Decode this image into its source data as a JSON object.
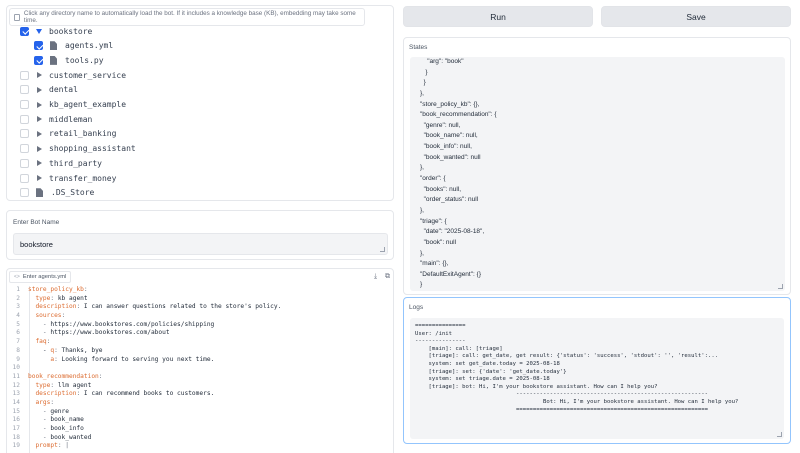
{
  "tree": {
    "info": "Click any directory name to automatically load the bot. If it includes a knowledge base (KB), embedding may take some time.",
    "items": [
      {
        "label": "bookstore",
        "checked": true,
        "type": "folder-open",
        "indent": 0
      },
      {
        "label": "agents.yml",
        "checked": true,
        "type": "file",
        "indent": 1
      },
      {
        "label": "tools.py",
        "checked": true,
        "type": "file",
        "indent": 1
      },
      {
        "label": "customer_service",
        "checked": false,
        "type": "folder",
        "indent": 0
      },
      {
        "label": "dental",
        "checked": false,
        "type": "folder",
        "indent": 0
      },
      {
        "label": "kb_agent_example",
        "checked": false,
        "type": "folder",
        "indent": 0
      },
      {
        "label": "middleman",
        "checked": false,
        "type": "folder",
        "indent": 0
      },
      {
        "label": "retail_banking",
        "checked": false,
        "type": "folder",
        "indent": 0
      },
      {
        "label": "shopping_assistant",
        "checked": false,
        "type": "folder",
        "indent": 0
      },
      {
        "label": "third_party",
        "checked": false,
        "type": "folder",
        "indent": 0
      },
      {
        "label": "transfer_money",
        "checked": false,
        "type": "folder",
        "indent": 0
      },
      {
        "label": ".DS_Store",
        "checked": false,
        "type": "file",
        "indent": 0
      }
    ]
  },
  "bot_name": {
    "label": "Enter Bot Name",
    "value": "bookstore"
  },
  "code": {
    "tab_label": "Enter agents.yml",
    "lines": [
      {
        "n": "1",
        "key": "store_policy_kb",
        "pun": ":",
        "val": "",
        "indent": ""
      },
      {
        "n": "2",
        "key": "type",
        "pun": ": ",
        "val": "kb agent",
        "indent": "  "
      },
      {
        "n": "3",
        "key": "description",
        "pun": ": ",
        "val": "I can answer questions related to the store's policy.",
        "indent": "  "
      },
      {
        "n": "4",
        "key": "sources",
        "pun": ":",
        "val": "",
        "indent": "  "
      },
      {
        "n": "5",
        "key": "",
        "pun": "- ",
        "val": "https://www.bookstores.com/policies/shipping",
        "indent": "    "
      },
      {
        "n": "6",
        "key": "",
        "pun": "- ",
        "val": "https://www.bookstores.com/about",
        "indent": "    "
      },
      {
        "n": "7",
        "key": "faq",
        "pun": ":",
        "val": "",
        "indent": "  "
      },
      {
        "n": "8",
        "key": "q",
        "pun": ": ",
        "val": "Thanks, bye",
        "indent": "    - "
      },
      {
        "n": "9",
        "key": "a",
        "pun": ": ",
        "val": "Looking forward to serving you next time.",
        "indent": "      "
      },
      {
        "n": "10",
        "key": "",
        "pun": "",
        "val": "",
        "indent": ""
      },
      {
        "n": "11",
        "key": "book_recommendation",
        "pun": ":",
        "val": "",
        "indent": ""
      },
      {
        "n": "12",
        "key": "type",
        "pun": ": ",
        "val": "llm agent",
        "indent": "  "
      },
      {
        "n": "13",
        "key": "description",
        "pun": ": ",
        "val": "I can recommend books to customers.",
        "indent": "  "
      },
      {
        "n": "14",
        "key": "args",
        "pun": ":",
        "val": "",
        "indent": "  "
      },
      {
        "n": "15",
        "key": "",
        "pun": "- ",
        "val": "genre",
        "indent": "    "
      },
      {
        "n": "16",
        "key": "",
        "pun": "- ",
        "val": "book_name",
        "indent": "    "
      },
      {
        "n": "17",
        "key": "",
        "pun": "- ",
        "val": "book_info",
        "indent": "    "
      },
      {
        "n": "18",
        "key": "",
        "pun": "- ",
        "val": "book_wanted",
        "indent": "    "
      },
      {
        "n": "19",
        "key": "prompt",
        "pun": ": |",
        "val": "",
        "indent": "  "
      }
    ]
  },
  "buttons": {
    "run": "Run",
    "save": "Save"
  },
  "states": {
    "label": "States",
    "lines": [
      "    \"arg\": \"book\"",
      "   }",
      "  }",
      "},",
      "\"store_policy_kb\": {},",
      "\"book_recommendation\": {",
      "  \"genre\": null,",
      "  \"book_name\": null,",
      "  \"book_info\": null,",
      "  \"book_wanted\": null",
      "},",
      "\"order\": {",
      "  \"books\": null,",
      "  \"order_status\": null",
      "},",
      "\"triage\": {",
      "  \"date\": \"2025-08-18\",",
      "  \"book\": null",
      "},",
      "\"main\": {},",
      "\"DefaultExitAgent\": {}",
      "}"
    ]
  },
  "logs": {
    "label": "Logs",
    "lines": [
      "===============",
      "User: /init",
      "---------------",
      "    [main]: call: [triage]",
      "    [triage]: call: get_date, get result: {'status': 'success', 'stdout': '', 'result':...",
      "    system: set get_date.today = 2025-08-18",
      "    [triage]: set: {'date': 'get_date.today'}",
      "    system: set triage.date = 2025-08-18",
      "    [triage]: bot: Hi, I'm your bookstore assistant. How can I help you?",
      "                              ---------------------------------------------------------",
      "                                      Bot: Hi, I'm your bookstore assistant. How can I help you?",
      "                              ========================================================="
    ]
  }
}
